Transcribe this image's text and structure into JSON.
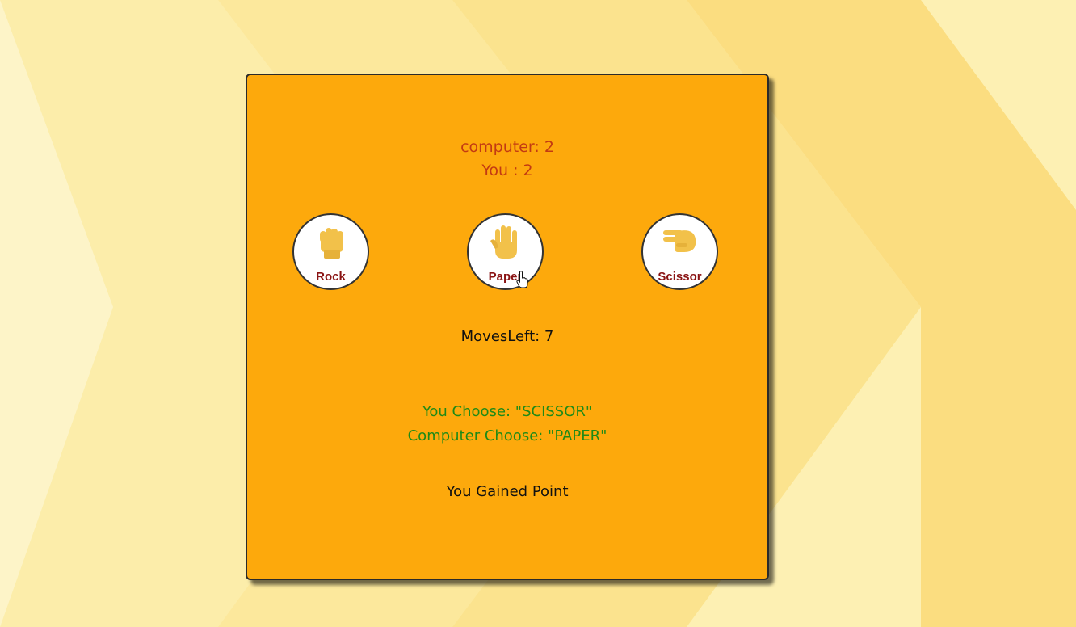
{
  "score": {
    "computer": "computer: 2",
    "you": "You : 2"
  },
  "choices": [
    {
      "label": "Rock",
      "icon": "fist-icon"
    },
    {
      "label": "Paper",
      "icon": "open-hand-icon"
    },
    {
      "label": "Scissor",
      "icon": "victory-hand-icon"
    }
  ],
  "moves_left": "MovesLeft: 7",
  "result": {
    "you_choose": "You Choose: \"SCISSOR\"",
    "computer_choose": "Computer Choose: \"PAPER\""
  },
  "message": "You Gained Point",
  "colors": {
    "background": "#fbe58a",
    "panel": "#fda90c",
    "score_text": "#c33a12",
    "result_text": "#1e8a17",
    "choice_label": "#8a1414",
    "hand": "#f2c14a"
  }
}
